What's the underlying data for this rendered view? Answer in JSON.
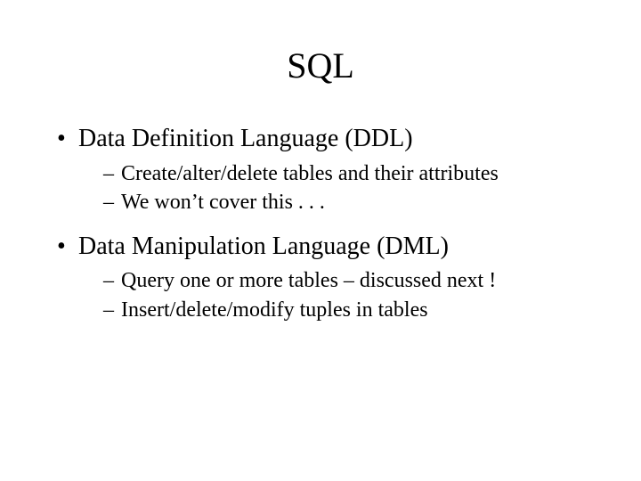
{
  "title": "SQL",
  "bullets": [
    {
      "text": "Data Definition Language (DDL)",
      "sub": [
        "Create/alter/delete tables and their attributes",
        "We won’t cover this . . ."
      ]
    },
    {
      "text": "Data Manipulation Language (DML)",
      "sub": [
        "Query one or more tables – discussed next !",
        "Insert/delete/modify tuples in tables"
      ]
    }
  ]
}
